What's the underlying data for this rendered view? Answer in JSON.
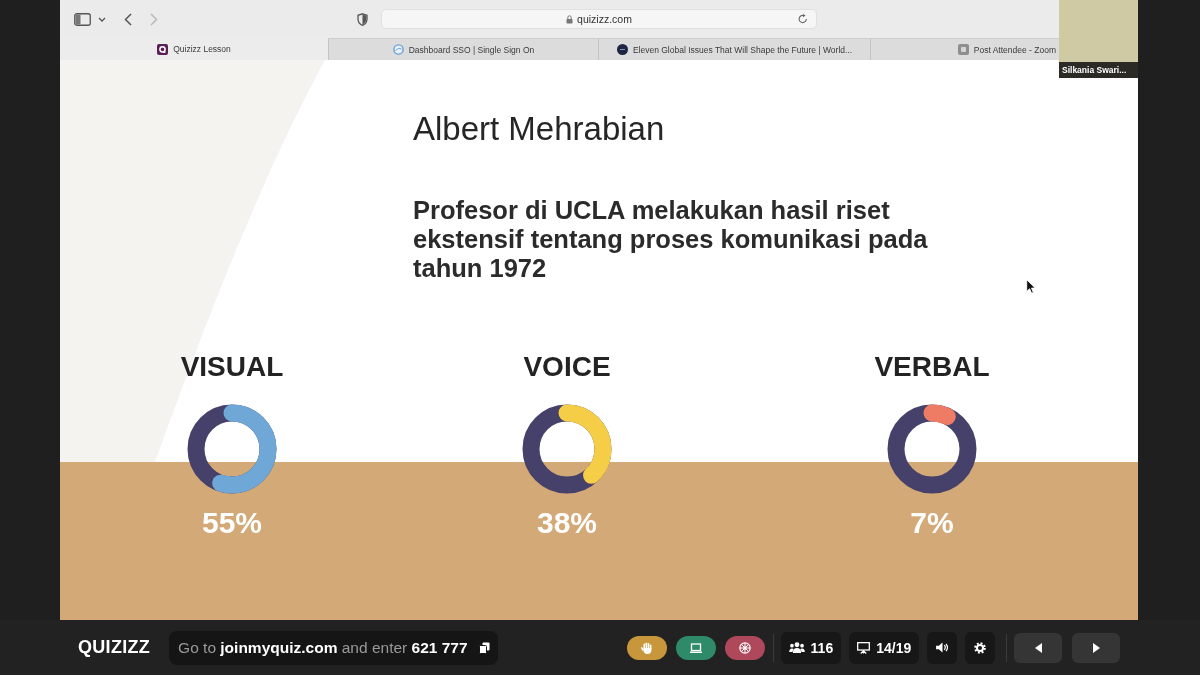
{
  "browser": {
    "nav_buttons": [
      {
        "kind": "back",
        "disabled": false
      },
      {
        "kind": "forward",
        "disabled": true
      }
    ],
    "url": "quizizz.com",
    "tabs": [
      {
        "kind": "q-square",
        "title": "Quizizz Lesson",
        "selected": true
      },
      {
        "kind": "ring",
        "title": "Dashboard SSO | Single Sign On",
        "selected": false
      },
      {
        "kind": "dark-circle",
        "title": "Eleven Global Issues That Will Shape the Future | World...",
        "selected": false
      },
      {
        "kind": "grey-square",
        "title": "Post Attendee - Zoom",
        "selected": false
      }
    ]
  },
  "video_tile": {
    "name": "Silkania Swari..."
  },
  "slide": {
    "title": "Albert Mehrabian",
    "body": "Profesor di UCLA melakukan hasil riset ekstensif tentang proses komunikasi pada tahun 1972",
    "stats": [
      {
        "label": "VISUAL",
        "value": "55%",
        "level": 0.55,
        "color": "#6fa8d6"
      },
      {
        "label": "VOICE",
        "value": "38%",
        "level": 0.38,
        "color": "#f5cd47"
      },
      {
        "label": "VERBAL",
        "value": "7%",
        "level": 0.07,
        "color": "#ee7b63"
      }
    ]
  },
  "bottom_bar": {
    "logo": "QUIZIZZ",
    "join_text": "Go to **joinmyquiz.com** and enter **621 777**",
    "action_buttons": [
      {
        "kind": "hand",
        "color": "#c8973b"
      },
      {
        "kind": "screen",
        "color": "#2e8a68"
      },
      {
        "kind": "wheel",
        "color": "#b0485c"
      }
    ],
    "participants": "116",
    "slide_counter": "14/19"
  }
}
